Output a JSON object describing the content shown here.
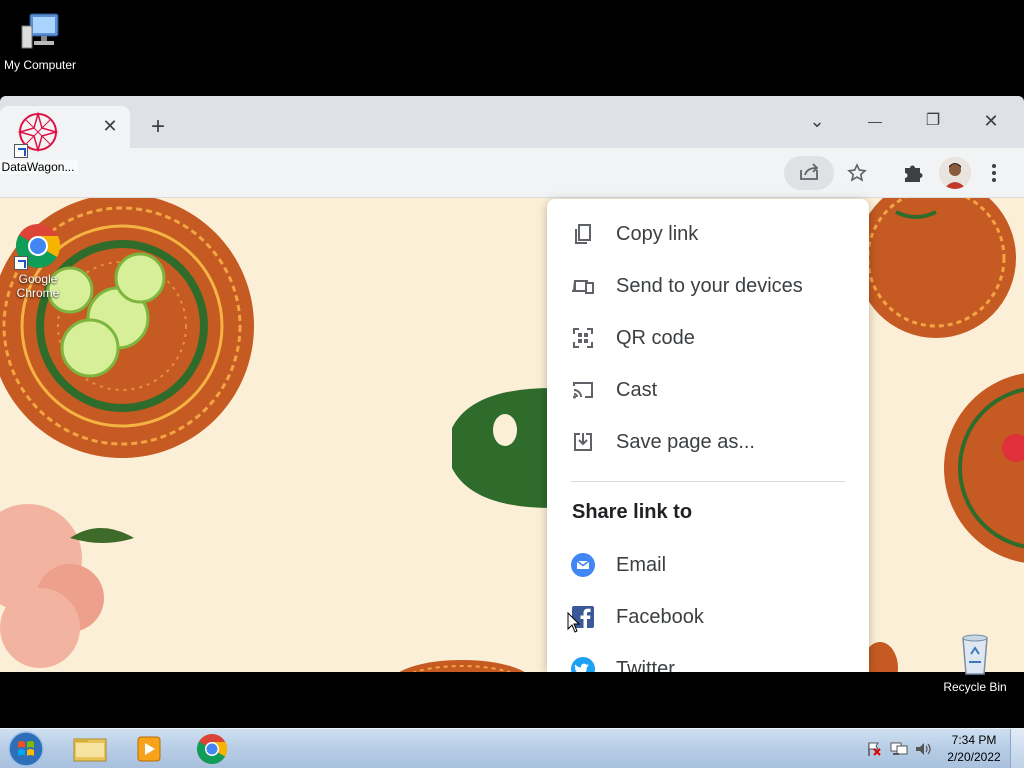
{
  "desktop": {
    "icons": [
      {
        "label": "My Computer"
      },
      {
        "label": "DataWagon..."
      },
      {
        "label": "Google Chrome"
      },
      {
        "label": "Recycle Bin"
      }
    ]
  },
  "browser": {
    "tab_close_symbol": "✕",
    "new_tab_symbol": "+",
    "window_controls": {
      "tab_search": "⌄",
      "minimize": "—",
      "restore": "❐",
      "close": "✕"
    },
    "icons": {
      "share": "share-icon",
      "bookmark": "star-icon",
      "extensions": "puzzle-icon",
      "profile": "avatar",
      "menu": "more-vert-icon"
    }
  },
  "share_menu": {
    "items": [
      {
        "label": "Copy link",
        "icon": "copy-icon"
      },
      {
        "label": "Send to your devices",
        "icon": "devices-icon"
      },
      {
        "label": "QR code",
        "icon": "qr-code-icon"
      },
      {
        "label": "Cast",
        "icon": "cast-icon"
      },
      {
        "label": "Save page as...",
        "icon": "download-icon"
      }
    ],
    "share_heading": "Share link to",
    "share_targets": [
      {
        "label": "Email",
        "icon": "email-icon",
        "color": "#4285f4"
      },
      {
        "label": "Facebook",
        "icon": "facebook-icon",
        "color": "#3b5998"
      },
      {
        "label": "Twitter",
        "icon": "twitter-icon",
        "color": "#1da1f2"
      }
    ]
  },
  "taskbar": {
    "apps": [
      {
        "name": "windows-explorer"
      },
      {
        "name": "media-player"
      },
      {
        "name": "google-chrome"
      }
    ],
    "clock": {
      "time": "7:34 PM",
      "date": "2/20/2022"
    }
  }
}
